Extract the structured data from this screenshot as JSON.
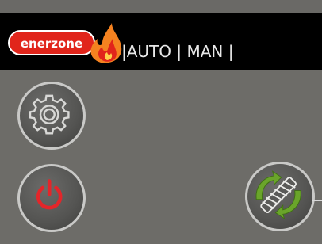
{
  "header": {
    "brand_text": "enerzone",
    "mode_label": "|AUTO | MAN |"
  },
  "icons": {
    "settings": "gear-icon",
    "power": "power-icon",
    "auger": "auger-rotate-icon"
  },
  "colors": {
    "background": "#6d6c68",
    "header_bg": "#000000",
    "brand_red": "#e1251b",
    "flame_orange": "#f58220",
    "power_red": "#e3262a",
    "auger_green": "#6aa52a",
    "ring": "#c9c9c7"
  }
}
